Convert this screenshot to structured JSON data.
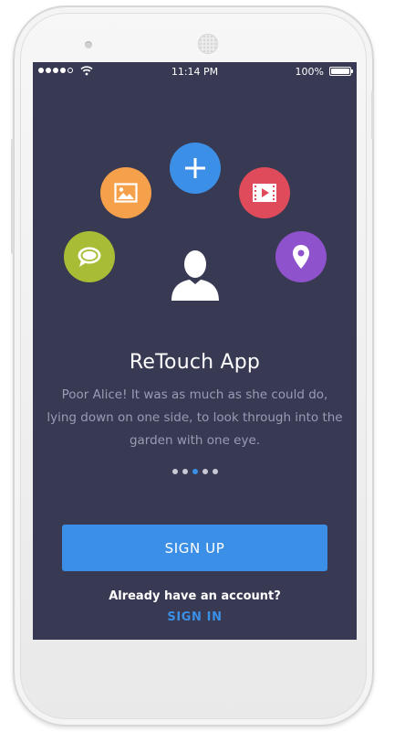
{
  "status_bar": {
    "time": "11:14 PM",
    "battery_percent": "100%",
    "signal_bars": 4,
    "icons": [
      "signal-dots-icon",
      "wifi-icon",
      "battery-icon"
    ]
  },
  "features": [
    {
      "name": "add",
      "icon": "plus-icon",
      "color": "#3b8fe6"
    },
    {
      "name": "gallery",
      "icon": "image-icon",
      "color": "#f5a04a"
    },
    {
      "name": "video",
      "icon": "video-play-icon",
      "color": "#e04b5b"
    },
    {
      "name": "chat",
      "icon": "chat-bubble-icon",
      "color": "#a8bd35"
    },
    {
      "name": "location",
      "icon": "location-pin-icon",
      "color": "#8f52cd"
    }
  ],
  "avatar_icon": "user-avatar-icon",
  "app": {
    "title": "ReTouch App",
    "description": "Poor Alice! It was as much as she could do, lying down on one side, to look through into the garden with one eye."
  },
  "pager": {
    "count": 5,
    "active_index": 2,
    "active_color": "#3b8fe6"
  },
  "actions": {
    "signup_label": "SIGN UP",
    "have_account_text": "Already have an account?",
    "signin_label": "SIGN IN"
  },
  "colors": {
    "screen_bg": "#383952",
    "accent": "#3b8fe6",
    "description_text": "#9a9bb4"
  }
}
